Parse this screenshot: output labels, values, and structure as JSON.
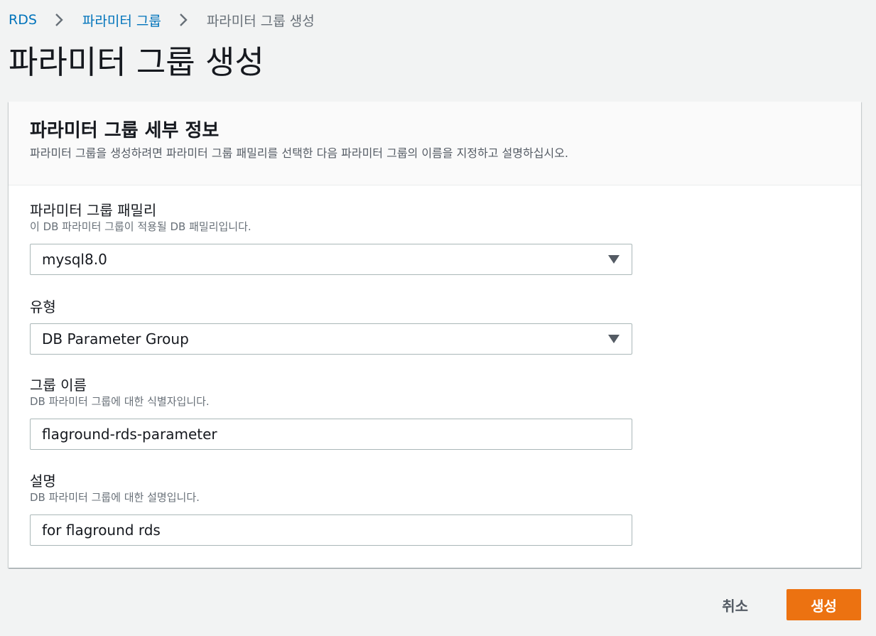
{
  "breadcrumb": {
    "items": [
      "RDS",
      "파라미터 그룹",
      "파라미터 그룹 생성"
    ]
  },
  "page": {
    "title": "파라미터 그룹 생성"
  },
  "panel": {
    "title": "파라미터 그룹 세부 정보",
    "description": "파라미터 그룹을 생성하려면 파라미터 그룹 패밀리를 선택한 다음 파라미터 그룹의 이름을 지정하고 설명하십시오."
  },
  "form": {
    "family": {
      "label": "파라미터 그룹 패밀리",
      "hint": "이 DB 파라미터 그룹이 적용될 DB 패밀리입니다.",
      "value": "mysql8.0"
    },
    "type": {
      "label": "유형",
      "value": "DB Parameter Group"
    },
    "name": {
      "label": "그룹 이름",
      "hint": "DB 파라미터 그룹에 대한 식별자입니다.",
      "value": "flaground-rds-parameter"
    },
    "description": {
      "label": "설명",
      "hint": "DB 파라미터 그룹에 대한 설명입니다.",
      "value": "for flaground rds"
    }
  },
  "actions": {
    "cancel_label": "취소",
    "create_label": "생성"
  },
  "icons": {
    "breadcrumb_separator": "chevron-right-icon",
    "select_caret": "caret-down-icon"
  },
  "colors": {
    "link": "#0073bb",
    "primary_button": "#ec7211",
    "page_background": "#f2f3f3"
  }
}
